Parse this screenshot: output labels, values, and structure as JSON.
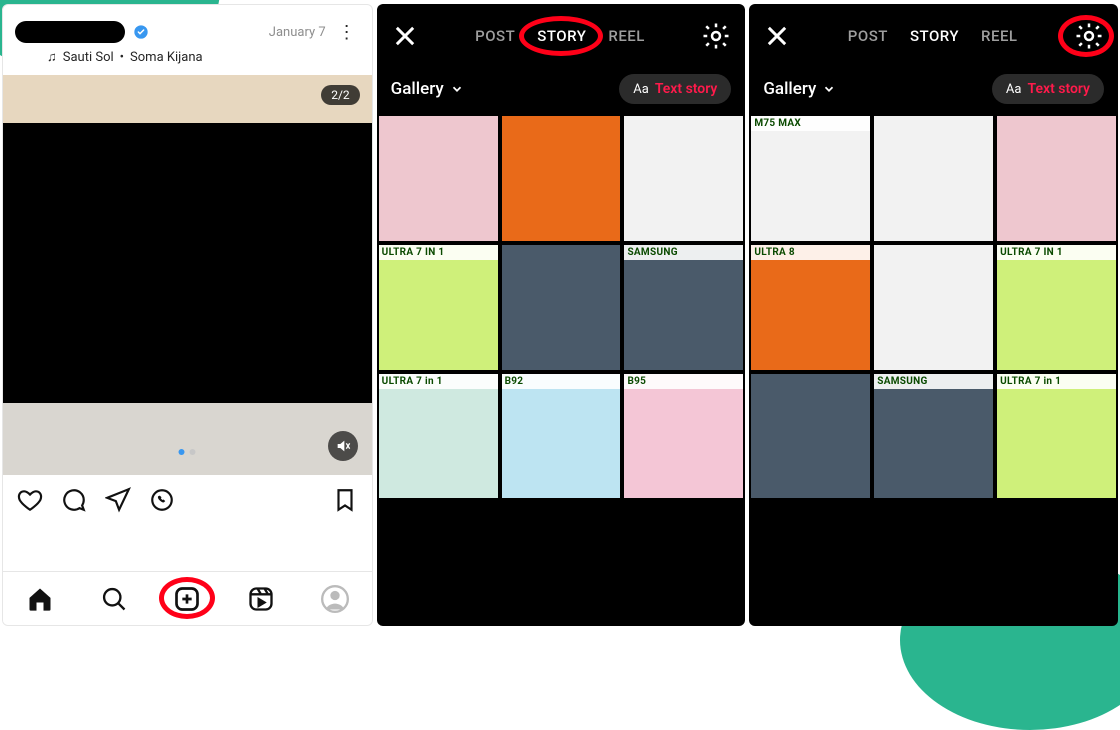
{
  "colors": {
    "highlight": "#ff0018",
    "verified": "#3897f0",
    "accent_pink": "#ff1a4b",
    "brand_green": "#2ab58f"
  },
  "panel1": {
    "verified": true,
    "music_artist": "Sauti Sol",
    "music_dot": "•",
    "music_track": "Soma Kijana",
    "date": "January 7",
    "carousel": "2/2",
    "icons": {
      "music": "music-note-icon",
      "more": "more-vertical-icon",
      "mute": "sound-muted-icon",
      "like": "heart-icon",
      "comment": "comment-icon",
      "share": "send-icon",
      "whatsapp": "whatsapp-icon",
      "save": "bookmark-icon"
    },
    "nav": {
      "home": "home-icon",
      "search": "search-icon",
      "create": "plus-square-icon",
      "reels": "reels-icon",
      "profile": "profile-avatar"
    }
  },
  "panel2": {
    "tabs": [
      "POST",
      "STORY",
      "REEL"
    ],
    "active_tab": "STORY",
    "gallery_label": "Gallery",
    "text_story_aa": "Aa",
    "text_story_label": "Text story",
    "icons": {
      "close": "close-icon",
      "gear": "settings-gear-icon",
      "dropdown": "chevron-down-icon"
    },
    "thumbs": [
      {
        "tone": "t-pink",
        "label": ""
      },
      {
        "tone": "t-orange",
        "label": ""
      },
      {
        "tone": "t-boxwhite",
        "label": ""
      },
      {
        "tone": "t-lime",
        "label": "ULTRA 7 IN 1"
      },
      {
        "tone": "t-dblue",
        "label": ""
      },
      {
        "tone": "t-dblue",
        "label": "SAMSUNG"
      },
      {
        "tone": "t-green",
        "label": "ULTRA 7 in 1"
      },
      {
        "tone": "t-cyan",
        "label": "B92"
      },
      {
        "tone": "t-pastelpink",
        "label": "B95"
      }
    ]
  },
  "panel3": {
    "tabs": [
      "POST",
      "STORY",
      "REEL"
    ],
    "active_tab": "STORY",
    "gallery_label": "Gallery",
    "text_story_aa": "Aa",
    "text_story_label": "Text story",
    "icons": {
      "close": "close-icon",
      "gear": "settings-gear-icon",
      "dropdown": "chevron-down-icon"
    },
    "thumbs": [
      {
        "tone": "t-boxwhite",
        "label": "M75  MAX"
      },
      {
        "tone": "t-boxwhite",
        "label": ""
      },
      {
        "tone": "t-pink",
        "label": ""
      },
      {
        "tone": "t-orange",
        "label": "ULTRA 8"
      },
      {
        "tone": "t-boxwhite",
        "label": ""
      },
      {
        "tone": "t-lime",
        "label": "ULTRA 7 IN 1"
      },
      {
        "tone": "t-dblue",
        "label": ""
      },
      {
        "tone": "t-dblue",
        "label": "SAMSUNG"
      },
      {
        "tone": "t-lime",
        "label": "ULTRA 7 in 1"
      }
    ]
  }
}
